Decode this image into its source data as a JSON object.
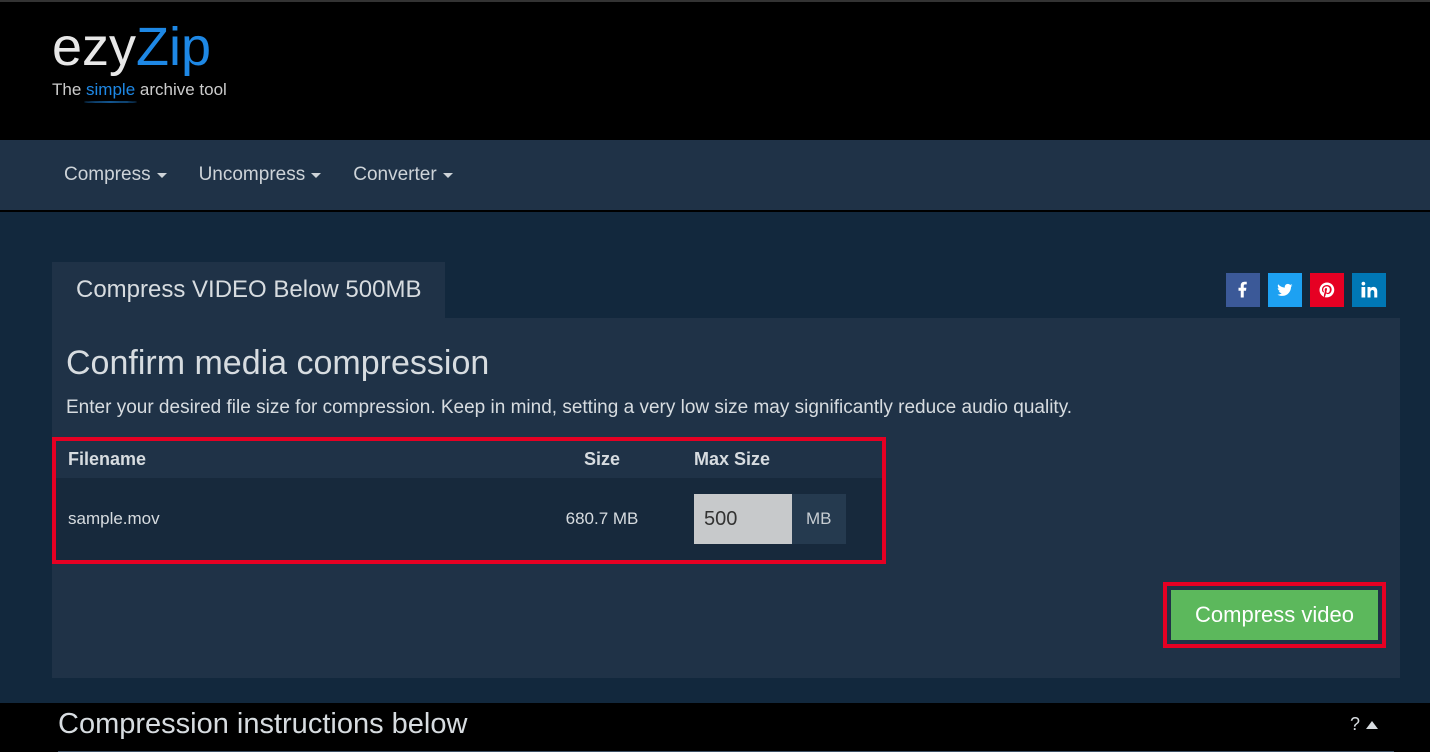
{
  "logo": {
    "part1": "ezy",
    "part2": "Zip",
    "tagline_pre": "The ",
    "tagline_simple": "simple",
    "tagline_post": " archive tool"
  },
  "nav": {
    "compress": "Compress",
    "uncompress": "Uncompress",
    "converter": "Converter"
  },
  "tab": {
    "label": "Compress VIDEO Below 500MB"
  },
  "socials": {
    "fb": "f",
    "tw": "tw",
    "pn": "pn",
    "li": "in"
  },
  "panel": {
    "heading": "Confirm media compression",
    "subtext": "Enter your desired file size for compression. Keep in mind, setting a very low size may significantly reduce audio quality."
  },
  "table": {
    "headers": {
      "filename": "Filename",
      "size": "Size",
      "maxsize": "Max Size"
    },
    "rows": [
      {
        "filename": "sample.mov",
        "size": "680.7 MB",
        "max": "500",
        "unit": "MB"
      }
    ]
  },
  "buttons": {
    "compress": "Compress video"
  },
  "instructions": {
    "title": "Compression instructions below",
    "help": "?"
  }
}
